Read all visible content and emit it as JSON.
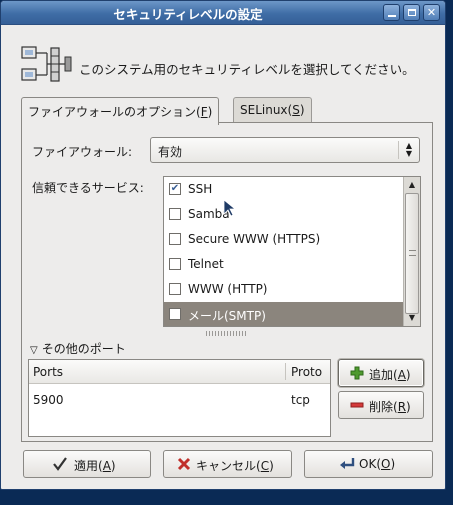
{
  "window": {
    "title": "セキュリティレベルの設定"
  },
  "header": {
    "icon": "network-firewall-icon",
    "text": "このシステム用のセキュリティレベルを選択してください。"
  },
  "tabs": [
    {
      "label": "ファイアウォールのオプション(",
      "mnemonic": "F",
      "close": ")",
      "active": true
    },
    {
      "label": "SELinux(",
      "mnemonic": "S",
      "close": ")",
      "active": false
    }
  ],
  "firewall": {
    "label": "ファイアウォール:",
    "value": "有効"
  },
  "services": {
    "label": "信頼できるサービス:",
    "items": [
      {
        "name": "SSH",
        "checked": true,
        "selected": false
      },
      {
        "name": "Samba",
        "checked": false,
        "selected": false
      },
      {
        "name": "Secure WWW (HTTPS)",
        "checked": false,
        "selected": false
      },
      {
        "name": "Telnet",
        "checked": false,
        "selected": false
      },
      {
        "name": "WWW (HTTP)",
        "checked": false,
        "selected": false
      },
      {
        "name": "メール(SMTP)",
        "checked": false,
        "selected": true
      }
    ]
  },
  "other_ports": {
    "label": "その他のポート",
    "columns": [
      "Ports",
      "Proto"
    ],
    "rows": [
      {
        "port": "5900",
        "proto": "tcp"
      }
    ],
    "add_label": "追加(",
    "add_mnemonic": "A",
    "delete_label": "削除(",
    "delete_mnemonic": "R",
    "close": ")"
  },
  "footer": {
    "apply_label": "適用(",
    "apply_mnemonic": "A",
    "cancel_label": "キャンセル(",
    "cancel_mnemonic": "C",
    "ok_label": "OK(",
    "ok_mnemonic": "O",
    "close": ")"
  },
  "colors": {
    "titlebar": "#4f7db6",
    "selection": "#8b857d",
    "window_bg": "#edeceb"
  }
}
